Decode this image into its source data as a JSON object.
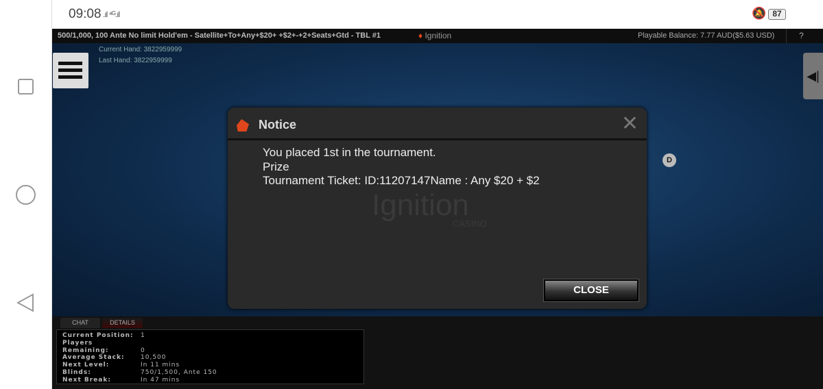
{
  "status": {
    "time": "09:08",
    "signal": ".ıl ⁴ᴳ.ıl",
    "battery": "87"
  },
  "titlebar": {
    "table": "500/1,000, 100 Ante No limit Hold'em - Satellite+To+Any+$20+ +$2+-+2+Seats+Gtd - TBL #1",
    "logo": "Ignition",
    "balance": "Playable Balance: 7.77 AUD($5.63 USD)",
    "help": "?"
  },
  "game": {
    "current_hand": "Current Hand: 3822959999",
    "last_hand": "Last Hand: 3822959999",
    "dealer": "D"
  },
  "dialog": {
    "title": "Notice",
    "lines": [
      "You placed 1st in the tournament.",
      "Prize",
      "Tournament Ticket: ID:11207147Name : Any $20 + $2"
    ],
    "watermark": "Ignition",
    "watermark_sub": "CASINO",
    "close": "CLOSE"
  },
  "bottom": {
    "tabs": [
      "CHAT",
      "DETAILS"
    ],
    "details": [
      [
        "Current Position:",
        "1"
      ],
      [
        "Players Remaining:",
        "0"
      ],
      [
        "Average Stack:",
        "10,500"
      ],
      [
        "Next Level:",
        "In 11 mins"
      ],
      [
        "Blinds:",
        "750/1,500, Ante 150"
      ],
      [
        "Next Break:",
        "In 47 mins"
      ]
    ]
  }
}
